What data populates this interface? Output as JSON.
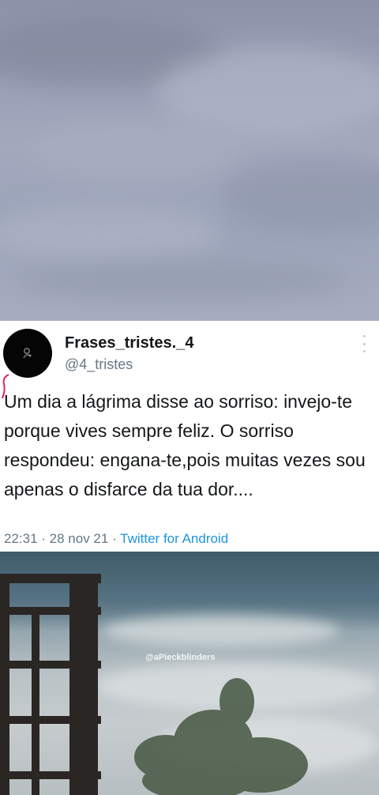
{
  "tweet": {
    "display_name": "Frases_tristes._4",
    "handle": "@4_tristes",
    "text": "Um dia a lágrima disse ao sorriso: invejo-te porque vives sempre feliz. O sorriso respondeu: engana-te,pois muitas vezes sou apenas o disfarce da tua dor....",
    "time": "22:31",
    "date": "28 nov 21",
    "source": "Twitter for Android",
    "separator": " · "
  },
  "video": {
    "watermark": "@aPieckblinders"
  },
  "icons": {
    "avatar": "avatar-icon",
    "more": "more-vertical-icon"
  },
  "colors": {
    "name": "#14171a",
    "secondary": "#657786",
    "link": "#1b95e0",
    "card_bg": "#ffffff"
  }
}
